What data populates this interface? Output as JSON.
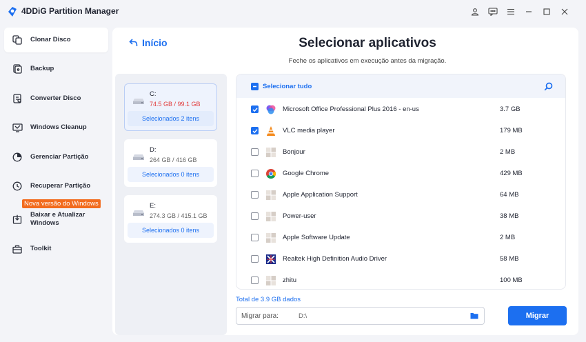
{
  "app": {
    "title": "4DDiG Partition Manager"
  },
  "titlebar": {
    "icons": [
      "user-icon",
      "feedback-icon",
      "menu-icon",
      "minimize-icon",
      "maximize-icon",
      "close-icon"
    ]
  },
  "sidebar": {
    "items": [
      {
        "label": "Clonar Disco",
        "icon": "clone-disk-icon",
        "active": true
      },
      {
        "label": "Backup",
        "icon": "backup-icon",
        "active": false
      },
      {
        "label": "Converter Disco",
        "icon": "convert-disk-icon",
        "active": false
      },
      {
        "label": "Windows Cleanup",
        "icon": "cleanup-icon",
        "active": false
      },
      {
        "label": "Gerenciar Partição",
        "icon": "partition-icon",
        "active": false
      },
      {
        "label": "Recuperar Partição",
        "icon": "recover-icon",
        "active": false
      },
      {
        "label": "Baixar e Atualizar Windows",
        "icon": "windows-update-icon",
        "active": false
      },
      {
        "label": "Toolkit",
        "icon": "toolkit-icon",
        "active": false
      }
    ],
    "promo_badge": "Nova versão do Windows"
  },
  "main": {
    "back_label": "Início",
    "title": "Selecionar aplicativos",
    "subtitle": "Feche os aplicativos em execução antes da migração."
  },
  "disks": [
    {
      "name": "C:",
      "usage": "74.5 GB / 99.1 GB",
      "selected_label": "Selecionados 2 itens",
      "selected": true,
      "warn": true
    },
    {
      "name": "D:",
      "usage": "264 GB / 416 GB",
      "selected_label": "Selecionados 0 itens",
      "selected": false,
      "warn": false
    },
    {
      "name": "E:",
      "usage": "274.3 GB / 415.1 GB",
      "selected_label": "Selecionados 0 itens",
      "selected": false,
      "warn": false
    }
  ],
  "apps": {
    "select_all_label": "Selecionar tudo",
    "rows": [
      {
        "name": "Microsoft Office Professional Plus 2016 - en-us",
        "size": "3.7 GB",
        "checked": true,
        "icon": "office-icon"
      },
      {
        "name": "VLC media player",
        "size": "179 MB",
        "checked": true,
        "icon": "vlc-icon"
      },
      {
        "name": "Bonjour",
        "size": "2 MB",
        "checked": false,
        "icon": "bonjour-icon"
      },
      {
        "name": "Google Chrome",
        "size": "429 MB",
        "checked": false,
        "icon": "chrome-icon"
      },
      {
        "name": "Apple Application Support",
        "size": "64 MB",
        "checked": false,
        "icon": "apple-support-icon"
      },
      {
        "name": "Power-user",
        "size": "38 MB",
        "checked": false,
        "icon": "power-user-icon"
      },
      {
        "name": "Apple Software Update",
        "size": "2 MB",
        "checked": false,
        "icon": "apple-update-icon"
      },
      {
        "name": "Realtek High Definition Audio Driver",
        "size": "58 MB",
        "checked": false,
        "icon": "realtek-icon"
      },
      {
        "name": "zhitu",
        "size": "100 MB",
        "checked": false,
        "icon": "generic-app-icon"
      }
    ]
  },
  "footer": {
    "total_label": "Total de 3.9 GB dados",
    "dest_label": "Migrar para:",
    "dest_value": "D:\\",
    "migrate_label": "Migrar"
  },
  "colors": {
    "accent": "#1c6ff0",
    "warning": "#e23a3a",
    "promo": "#f26b1d"
  }
}
